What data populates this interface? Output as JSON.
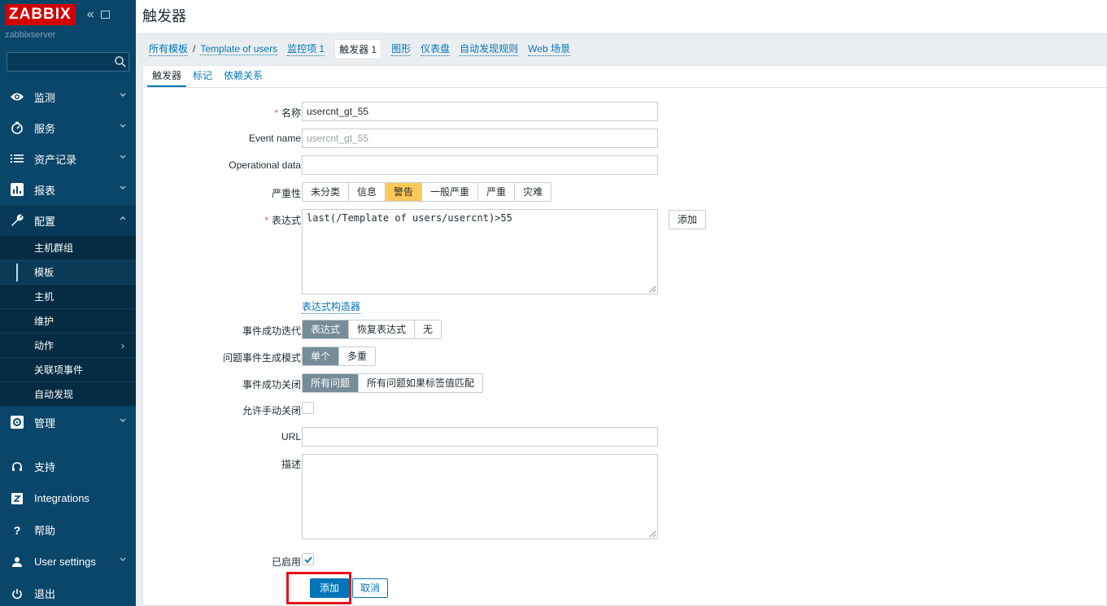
{
  "app": {
    "logo": "ZABBIX",
    "server": "zabbixserver",
    "page_title": "触发器"
  },
  "search": {
    "placeholder": ""
  },
  "sidebar": {
    "items": [
      {
        "label": "监测",
        "icon": "eye-icon"
      },
      {
        "label": "服务",
        "icon": "clock-icon"
      },
      {
        "label": "资产记录",
        "icon": "list-icon"
      },
      {
        "label": "报表",
        "icon": "bar-chart-icon"
      },
      {
        "label": "配置",
        "icon": "wrench-icon"
      }
    ],
    "config_sub": [
      {
        "label": "主机群组"
      },
      {
        "label": "模板"
      },
      {
        "label": "主机"
      },
      {
        "label": "维护"
      },
      {
        "label": "动作"
      },
      {
        "label": "关联项事件"
      },
      {
        "label": "自动发现"
      }
    ],
    "admin": {
      "label": "管理",
      "icon": "gear-icon"
    },
    "bottom": [
      {
        "label": "支持",
        "icon": "headset-icon"
      },
      {
        "label": "Integrations",
        "icon": "zabbix-z-icon"
      },
      {
        "label": "帮助",
        "icon": "question-icon"
      },
      {
        "label": "User settings",
        "icon": "user-icon"
      },
      {
        "label": "退出",
        "icon": "power-icon"
      }
    ]
  },
  "breadcrumb": {
    "all_templates": "所有模板",
    "separator": "/",
    "template": "Template of users",
    "items": "监控项 1",
    "triggers": "触发器 1",
    "graphs": "图形",
    "dashboards": "仪表盘",
    "discovery": "自动发现规则",
    "web": "Web 场景"
  },
  "tabs": [
    "触发器",
    "标记",
    "依赖关系"
  ],
  "form": {
    "name_label": "名称",
    "name_value": "usercnt_gt_55",
    "event_name_label": "Event name",
    "event_name_placeholder": "usercnt_gt_55",
    "opdata_label": "Operational data",
    "opdata_value": "",
    "severity_label": "严重性",
    "severity_options": [
      "未分类",
      "信息",
      "警告",
      "一般严重",
      "严重",
      "灾难"
    ],
    "severity_selected": "警告",
    "expression_label": "表达式",
    "expression_value": "last(/Template of users/usercnt)>55",
    "expression_add": "添加",
    "expression_builder": "表达式构造器",
    "ok_event_label": "事件成功迭代",
    "ok_event_options": [
      "表达式",
      "恢复表达式",
      "无"
    ],
    "ok_event_selected": "表达式",
    "problem_mode_label": "问题事件生成模式",
    "problem_mode_options": [
      "单个",
      "多重"
    ],
    "problem_mode_selected": "单个",
    "ok_close_label": "事件成功关闭",
    "ok_close_options": [
      "所有问题",
      "所有问题如果标签值匹配"
    ],
    "ok_close_selected": "所有问题",
    "manual_close_label": "允许手动关闭",
    "manual_close_checked": false,
    "url_label": "URL",
    "url_value": "",
    "desc_label": "描述",
    "desc_value": "",
    "enabled_label": "已启用",
    "enabled_checked": true,
    "submit": "添加",
    "cancel": "取消"
  },
  "colors": {
    "sidebar": "#0a466a",
    "accent": "#0275b8",
    "warning": "#ffc859",
    "highlight": "#e8101a"
  }
}
